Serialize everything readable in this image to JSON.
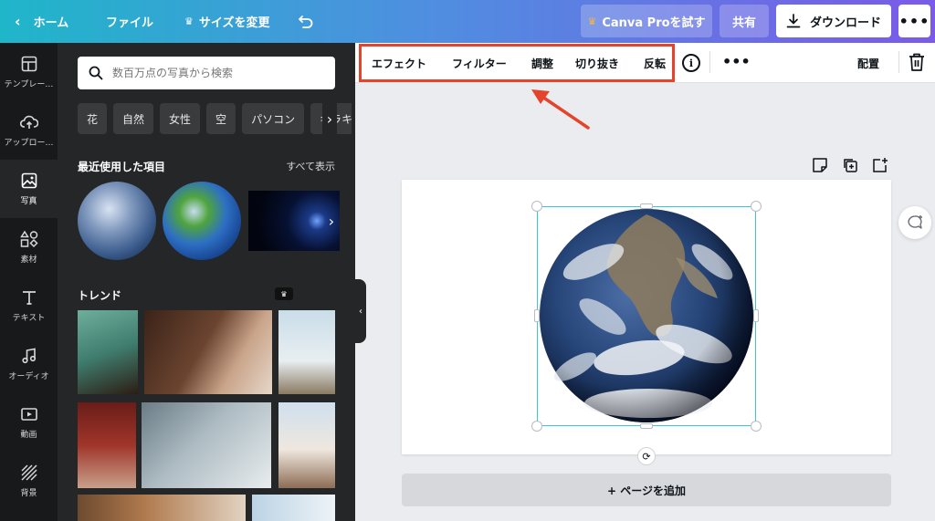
{
  "topbar": {
    "home_label": "ホーム",
    "file_label": "ファイル",
    "resize_label": "サイズを変更",
    "pro_label": "Canva Proを試す",
    "share_label": "共有",
    "download_label": "ダウンロード",
    "more_label": "•••"
  },
  "rail": {
    "items": [
      {
        "label": "テンプレー…"
      },
      {
        "label": "アップロー…"
      },
      {
        "label": "写真"
      },
      {
        "label": "素材"
      },
      {
        "label": "テキスト"
      },
      {
        "label": "オーディオ"
      },
      {
        "label": "動画"
      },
      {
        "label": "背景"
      }
    ]
  },
  "panel": {
    "search_placeholder": "数百万点の写真から検索",
    "chips": [
      "花",
      "自然",
      "女性",
      "空",
      "パソコン",
      "キラキ"
    ],
    "recent_title": "最近使用した項目",
    "see_all": "すべて表示",
    "trend_title": "トレンド"
  },
  "context_toolbar": {
    "effects": "エフェクト",
    "filters": "フィルター",
    "adjust": "調整",
    "crop": "切り抜き",
    "flip": "反転",
    "info": "i",
    "more": "•••",
    "position": "配置"
  },
  "canvas": {
    "add_page": "+ ページを追加"
  },
  "colors": {
    "highlight_box": "#e5432b",
    "selection": "#3dc5d1",
    "panel_bg": "#252627",
    "rail_bg": "#18191b"
  }
}
